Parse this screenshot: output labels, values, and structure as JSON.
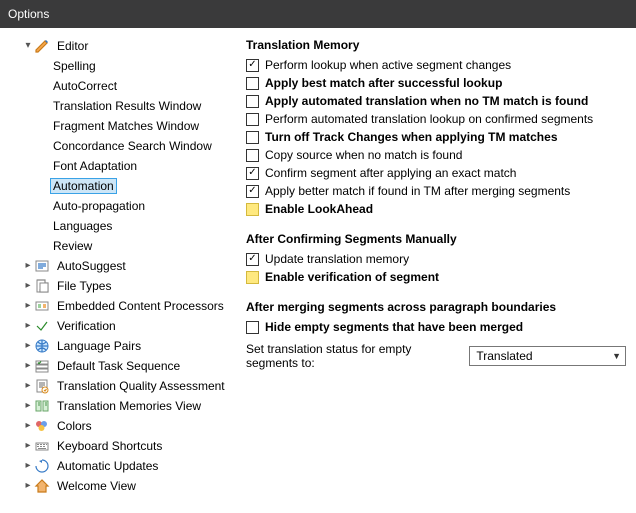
{
  "titlebar": {
    "title": "Options"
  },
  "tree": {
    "root": [
      {
        "id": "editor",
        "label": "Editor",
        "expanded": true,
        "icon": "pencil",
        "level": 1,
        "children": [
          {
            "id": "spelling",
            "label": "Spelling",
            "level": 2
          },
          {
            "id": "autocorrect",
            "label": "AutoCorrect",
            "level": 2
          },
          {
            "id": "trw",
            "label": "Translation Results Window",
            "level": 2
          },
          {
            "id": "fmw",
            "label": "Fragment Matches Window",
            "level": 2
          },
          {
            "id": "csw",
            "label": "Concordance Search Window",
            "level": 2
          },
          {
            "id": "fontadapt",
            "label": "Font Adaptation",
            "level": 2
          },
          {
            "id": "automation",
            "label": "Automation",
            "level": 2,
            "selected": true
          },
          {
            "id": "autoprop",
            "label": "Auto-propagation",
            "level": 2
          },
          {
            "id": "languages",
            "label": "Languages",
            "level": 2
          },
          {
            "id": "review",
            "label": "Review",
            "level": 2
          }
        ]
      },
      {
        "id": "autosuggest",
        "label": "AutoSuggest",
        "icon": "autosuggest",
        "expanded": false,
        "level": 1
      },
      {
        "id": "filetypes",
        "label": "File Types",
        "icon": "filetypes",
        "expanded": false,
        "level": 1
      },
      {
        "id": "ecp",
        "label": "Embedded Content Processors",
        "icon": "ecp",
        "expanded": false,
        "level": 1
      },
      {
        "id": "verify",
        "label": "Verification",
        "icon": "verify",
        "expanded": false,
        "level": 1
      },
      {
        "id": "langpairs",
        "label": "Language Pairs",
        "icon": "langpairs",
        "expanded": false,
        "level": 1
      },
      {
        "id": "dts",
        "label": "Default Task Sequence",
        "icon": "dts",
        "expanded": false,
        "level": 1
      },
      {
        "id": "tqa",
        "label": "Translation Quality Assessment",
        "icon": "tqa",
        "expanded": false,
        "level": 1
      },
      {
        "id": "tmv",
        "label": "Translation Memories View",
        "icon": "tmv",
        "expanded": false,
        "level": 1
      },
      {
        "id": "colors",
        "label": "Colors",
        "icon": "colors",
        "expanded": false,
        "level": 1
      },
      {
        "id": "kbshort",
        "label": "Keyboard Shortcuts",
        "icon": "keyboard",
        "expanded": false,
        "level": 1
      },
      {
        "id": "autoupd",
        "label": "Automatic Updates",
        "icon": "updates",
        "expanded": false,
        "level": 1
      },
      {
        "id": "welcome",
        "label": "Welcome View",
        "icon": "home",
        "expanded": false,
        "level": 1
      }
    ]
  },
  "panel": {
    "sections": [
      {
        "title": "Translation Memory",
        "options": [
          {
            "id": "lookup",
            "label": "Perform lookup when active segment changes",
            "checked": true,
            "bold": false,
            "highlight": false
          },
          {
            "id": "bestmatch",
            "label": "Apply best match after successful lookup",
            "checked": false,
            "bold": true,
            "highlight": false
          },
          {
            "id": "autotrans",
            "label": "Apply automated translation when no TM match is found",
            "checked": false,
            "bold": true,
            "highlight": false
          },
          {
            "id": "autolookup",
            "label": "Perform automated translation lookup on confirmed segments",
            "checked": false,
            "bold": false,
            "highlight": false
          },
          {
            "id": "turnofftc",
            "label": "Turn off Track Changes when applying TM matches",
            "checked": false,
            "bold": true,
            "highlight": false
          },
          {
            "id": "copysource",
            "label": "Copy source when no match is found",
            "checked": false,
            "bold": false,
            "highlight": false
          },
          {
            "id": "confirmexact",
            "label": "Confirm segment after applying an exact match",
            "checked": true,
            "bold": false,
            "highlight": false
          },
          {
            "id": "bettermatch",
            "label": "Apply better match if found in TM after merging segments",
            "checked": true,
            "bold": false,
            "highlight": false
          },
          {
            "id": "lookahead",
            "label": "Enable LookAhead",
            "checked": false,
            "bold": true,
            "highlight": true
          }
        ]
      },
      {
        "title": "After Confirming Segments Manually",
        "options": [
          {
            "id": "updatetm",
            "label": "Update translation memory",
            "checked": true,
            "bold": false,
            "highlight": false
          },
          {
            "id": "enableverif",
            "label": "Enable verification of segment",
            "checked": false,
            "bold": true,
            "highlight": true
          }
        ]
      },
      {
        "title": "After merging segments across paragraph boundaries",
        "options": [
          {
            "id": "hideempty",
            "label": "Hide empty segments that have been merged",
            "checked": false,
            "bold": true,
            "highlight": false
          }
        ],
        "combo": {
          "label": "Set translation status for empty segments to:",
          "value": "Translated"
        }
      }
    ]
  }
}
